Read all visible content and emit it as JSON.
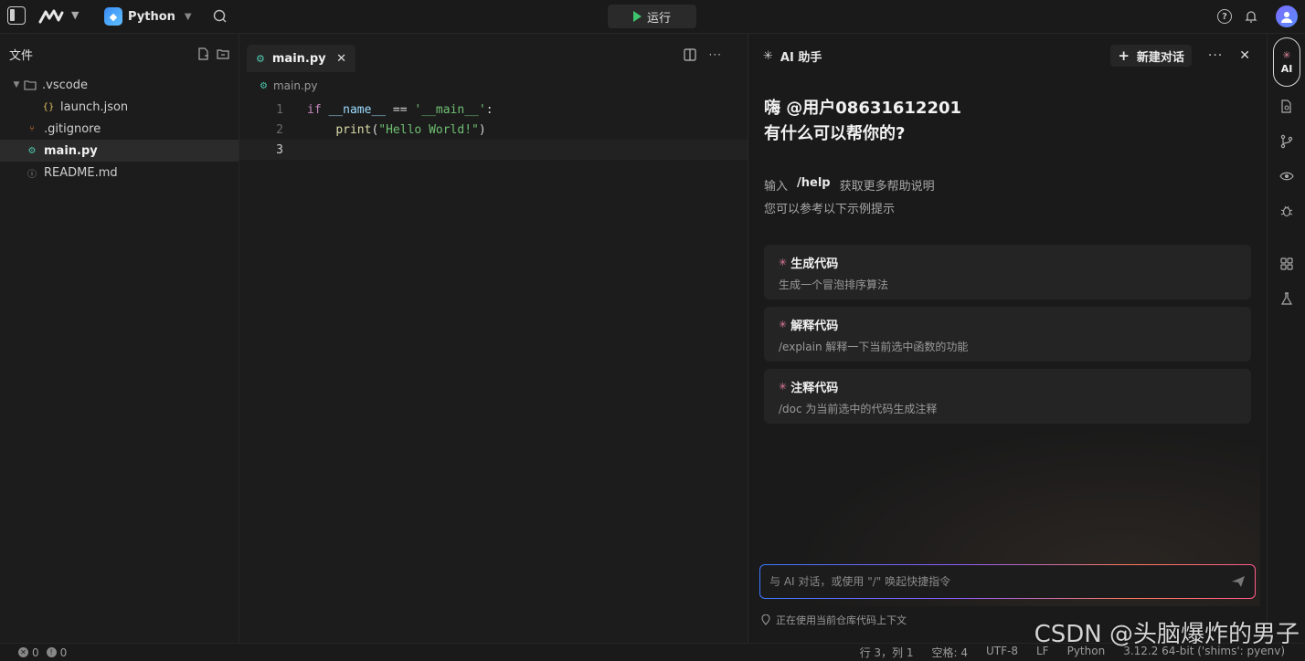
{
  "topbar": {
    "language": "Python",
    "run_label": "运行"
  },
  "sidebar": {
    "title": "文件",
    "items": [
      {
        "label": ".vscode",
        "type": "folder"
      },
      {
        "label": "launch.json",
        "type": "json"
      },
      {
        "label": ".gitignore",
        "type": "git"
      },
      {
        "label": "main.py",
        "type": "python",
        "selected": true
      },
      {
        "label": "README.md",
        "type": "markdown"
      }
    ]
  },
  "editor": {
    "tab_label": "main.py",
    "breadcrumb": "main.py",
    "line_numbers": [
      "1",
      "2",
      "3"
    ],
    "code": {
      "l1_kw": "if",
      "l1_name": "__name__",
      "l1_op": " == ",
      "l1_str": "'__main__'",
      "l1_colon": ":",
      "l2_fn": "print",
      "l2_open": "(",
      "l2_str": "\"Hello World!\"",
      "l2_close": ")"
    }
  },
  "ai_panel": {
    "title": "AI 助手",
    "new_chat_label": "新建对话",
    "greeting_line1": "嗨 @用户08631612201",
    "greeting_line2": "有什么可以帮你的?",
    "hint_prefix": "输入",
    "hint_cmd": "/help",
    "hint_suffix": "获取更多帮助说明",
    "hint2": "您可以参考以下示例提示",
    "cards": [
      {
        "title": "生成代码",
        "desc": "生成一个冒泡排序算法"
      },
      {
        "title": "解释代码",
        "desc": "/explain 解释一下当前选中函数的功能"
      },
      {
        "title": "注释代码",
        "desc": "/doc 为当前选中的代码生成注释"
      }
    ],
    "input_placeholder": "与 AI 对话，或使用 \"/\" 唤起快捷指令",
    "context_note": "正在使用当前仓库代码上下文"
  },
  "rail": {
    "ai_label": "AI"
  },
  "statusbar": {
    "errors": "0",
    "warnings": "0",
    "position": "行 3，列 1",
    "spaces": "空格: 4",
    "encoding": "UTF-8",
    "eol": "LF",
    "language": "Python",
    "interpreter": "3.12.2 64-bit ('shims': pyenv)"
  },
  "watermark": "CSDN @头脑爆炸的男子"
}
